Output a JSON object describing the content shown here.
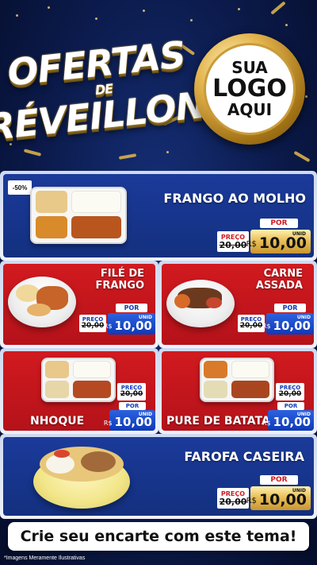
{
  "header": {
    "title_line1": "OFERTAS",
    "title_line2": "DE",
    "title_line3": "RÉVEILLON",
    "logo_line1": "SUA",
    "logo_line2": "LOGO",
    "logo_line3": "AQUI"
  },
  "products": [
    {
      "name": "FRANGO AO MOLHO",
      "badge": "-50%",
      "preco_label": "PREÇO",
      "old_price": "20,00",
      "por_label": "POR",
      "currency": "R$",
      "price": "10,00",
      "unit": "UNID"
    },
    {
      "name_line1": "FILÉ DE",
      "name_line2": "FRANGO",
      "preco_label": "PREÇO",
      "old_price": "20,00",
      "por_label": "POR",
      "currency": "R$",
      "price": "10,00",
      "unit": "UNID"
    },
    {
      "name_line1": "CARNE",
      "name_line2": "ASSADA",
      "preco_label": "PREÇO",
      "old_price": "20,00",
      "por_label": "POR",
      "currency": "R$",
      "price": "10,00",
      "unit": "UNID"
    },
    {
      "name": "NHOQUE",
      "preco_label": "PREÇO",
      "old_price": "20,00",
      "por_label": "POR",
      "currency": "R$",
      "price": "10,00",
      "unit": "UNID"
    },
    {
      "name": "PURE DE BATATA",
      "preco_label": "PREÇO",
      "old_price": "20,00",
      "por_label": "POR",
      "currency": "R$",
      "price": "10,00",
      "unit": "UNID"
    },
    {
      "name": "FAROFA CASEIRA",
      "preco_label": "PREÇO",
      "old_price": "20,00",
      "por_label": "POR",
      "currency": "R$",
      "price": "10,00",
      "unit": "UNID"
    }
  ],
  "cta": "Crie seu encarte com este tema!",
  "footnote": "*Imagens Meramente Ilustrativas",
  "colors": {
    "blue_panel": "#1b3a9a",
    "red_panel": "#d11a1f",
    "gold": "#e9c058",
    "price_blue": "#0f3ab8",
    "background": "#0b1a4a"
  },
  "icons": [
    "food-tray-image",
    "food-bowl-image",
    "logo-badge"
  ]
}
